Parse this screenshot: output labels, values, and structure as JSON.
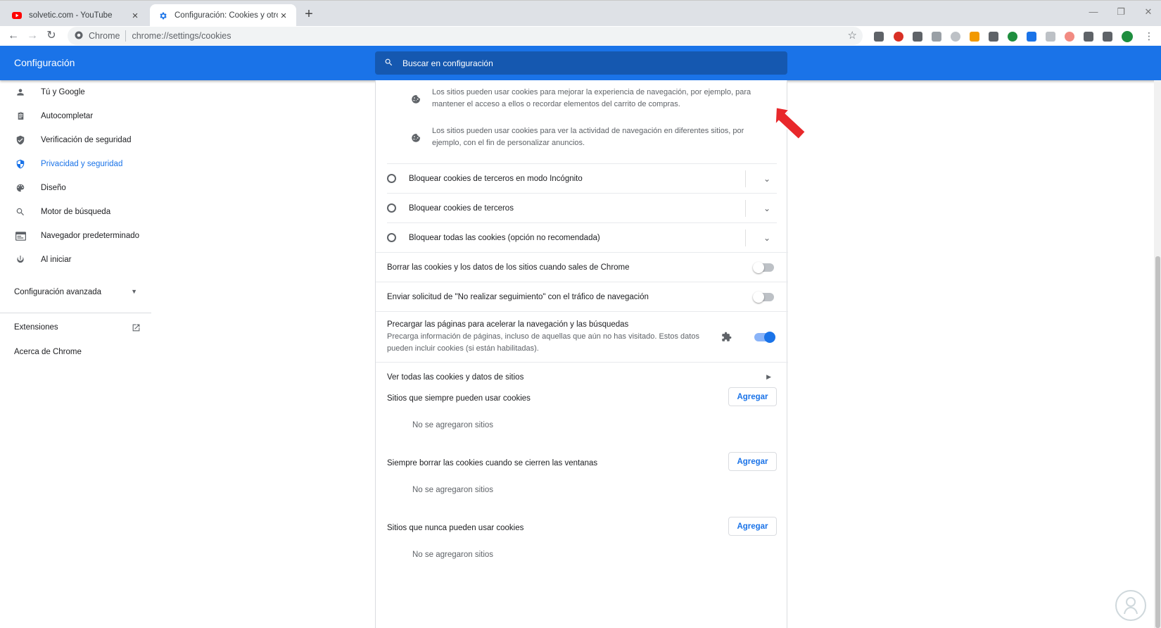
{
  "browser": {
    "tabs": [
      {
        "title": "solvetic.com - YouTube",
        "favicon": "youtube-icon"
      },
      {
        "title": "Configuración: Cookies y otros d",
        "favicon": "gear-icon",
        "active": true
      }
    ],
    "omnibox": {
      "site_label": "Chrome",
      "url": "chrome://settings/cookies"
    },
    "accent_color": "#1a73e8"
  },
  "header": {
    "title": "Configuración",
    "search_placeholder": "Buscar en configuración"
  },
  "sidebar": {
    "items": [
      {
        "label": "Tú y Google",
        "icon": "person-icon"
      },
      {
        "label": "Autocompletar",
        "icon": "clipboard-icon"
      },
      {
        "label": "Verificación de seguridad",
        "icon": "shield-check-icon"
      },
      {
        "label": "Privacidad y seguridad",
        "icon": "shield-icon",
        "active": true
      },
      {
        "label": "Diseño",
        "icon": "palette-icon"
      },
      {
        "label": "Motor de búsqueda",
        "icon": "search-icon"
      },
      {
        "label": "Navegador predeterminado",
        "icon": "browser-icon"
      },
      {
        "label": "Al iniciar",
        "icon": "power-icon"
      }
    ],
    "advanced": "Configuración avanzada",
    "extensions": "Extensiones",
    "about": "Acerca de Chrome"
  },
  "main": {
    "bullets": [
      "Los sitios pueden usar cookies para mejorar la experiencia de navegación, por ejemplo, para mantener el acceso a ellos o recordar elementos del carrito de compras.",
      "Los sitios pueden usar cookies para ver la actividad de navegación en diferentes sitios, por ejemplo, con el fin de personalizar anuncios."
    ],
    "radio_options": [
      "Bloquear cookies de terceros en modo Incógnito",
      "Bloquear cookies de terceros",
      "Bloquear todas las cookies (opción no recomendada)"
    ],
    "toggles": [
      {
        "label": "Borrar las cookies y los datos de los sitios cuando sales de Chrome",
        "on": false
      },
      {
        "label": "Enviar solicitud de \"No realizar seguimiento\" con el tráfico de navegación",
        "on": false
      }
    ],
    "preload": {
      "title": "Precargar las páginas para acelerar la navegación y las búsquedas",
      "description": "Precarga información de páginas, incluso de aquellas que aún no has visitado. Estos datos pueden incluir cookies (si están habilitadas).",
      "on": true
    },
    "see_all": "Ver todas las cookies y datos de sitios",
    "sections": [
      {
        "title": "Sitios que siempre pueden usar cookies",
        "button": "Agregar",
        "empty": "No se agregaron sitios"
      },
      {
        "title": "Siempre borrar las cookies cuando se cierren las ventanas",
        "button": "Agregar",
        "empty": "No se agregaron sitios"
      },
      {
        "title": "Sitios que nunca pueden usar cookies",
        "button": "Agregar",
        "empty": "No se agregaron sitios"
      }
    ]
  }
}
